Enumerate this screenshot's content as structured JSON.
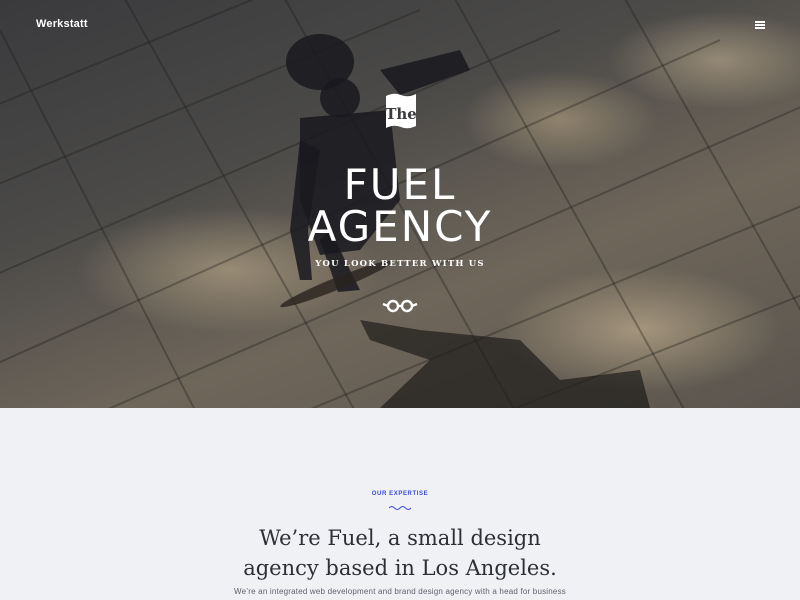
{
  "header": {
    "brand": "Werkstatt",
    "menu_icon": "hamburger-menu-icon"
  },
  "hero": {
    "badge_text": "The",
    "title_line1": "FUEL",
    "title_line2": "AGENCY",
    "tagline": "YOU LOOK BETTER WITH US",
    "glasses_icon": "glasses-icon"
  },
  "expertise": {
    "eyebrow": "OUR EXPERTISE",
    "wave_icon": "wave-divider-icon",
    "headline_line1": "We’re Fuel, a small design",
    "headline_line2": "agency based in Los Angeles.",
    "body": "We’re an integrated web development and brand design agency with a head for business"
  },
  "colors": {
    "accent": "#3b4bd6",
    "section_bg": "#f0f1f5",
    "headline": "#2d2f36"
  }
}
